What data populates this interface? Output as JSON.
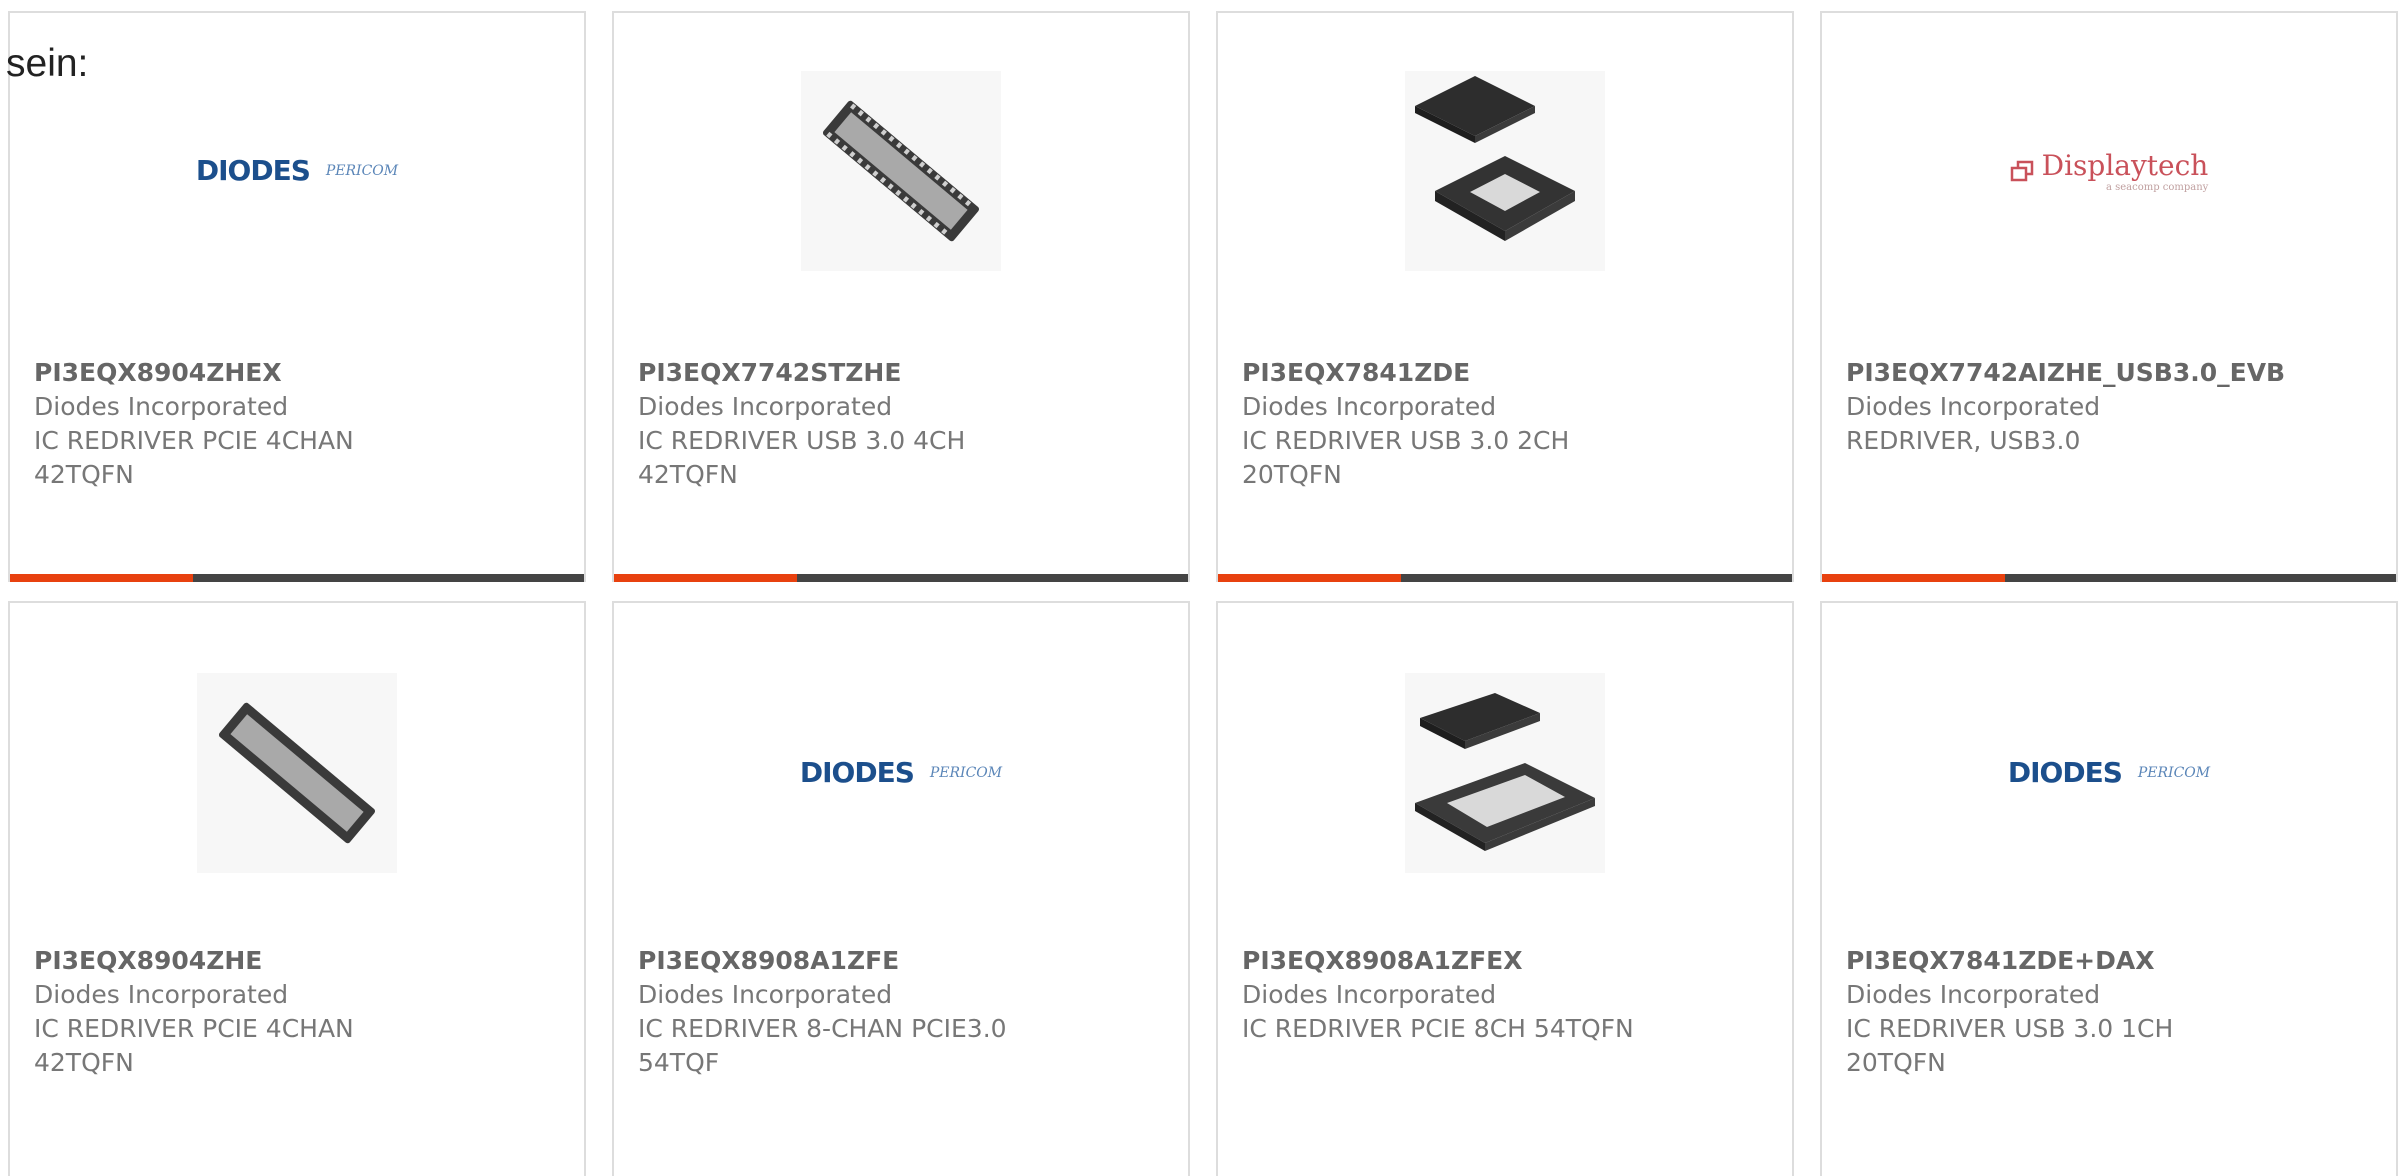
{
  "intro_text": "sein:",
  "colors": {
    "accent": "#e8410f",
    "bar": "#444444",
    "border": "#dddddd"
  },
  "products": [
    {
      "part": "PI3EQX8904ZHEX",
      "manufacturer": "Diodes Incorporated",
      "description": "IC REDRIVER PCIE 4CHAN\n42TQFN",
      "image": "diodes-pericom-logo"
    },
    {
      "part": "PI3EQX7742STZHE",
      "manufacturer": "Diodes Incorporated",
      "description": "IC REDRIVER USB 3.0 4CH\n42TQFN",
      "image": "chip-tqfn-42"
    },
    {
      "part": "PI3EQX7841ZDE",
      "manufacturer": "Diodes Incorporated",
      "description": "IC REDRIVER USB 3.0 2CH\n20TQFN",
      "image": "chip-tqfn-20"
    },
    {
      "part": "PI3EQX7742AIZHE_USB3.0_EVB",
      "manufacturer": "Diodes Incorporated",
      "description": "REDRIVER, USB3.0",
      "image": "displaytech-logo"
    },
    {
      "part": "PI3EQX8904ZHE",
      "manufacturer": "Diodes Incorporated",
      "description": "IC REDRIVER PCIE 4CHAN\n42TQFN",
      "image": "chip-tqfn-42"
    },
    {
      "part": "PI3EQX8908A1ZFE",
      "manufacturer": "Diodes Incorporated",
      "description": "IC REDRIVER 8-CHAN PCIE3.0\n54TQF",
      "image": "diodes-pericom-logo"
    },
    {
      "part": "PI3EQX8908A1ZFEX",
      "manufacturer": "Diodes Incorporated",
      "description": "IC REDRIVER PCIE 8CH 54TQFN",
      "image": "chip-tqfn-54"
    },
    {
      "part": "PI3EQX7841ZDE+DAX",
      "manufacturer": "Diodes Incorporated",
      "description": "IC REDRIVER USB 3.0 1CH\n20TQFN",
      "image": "diodes-pericom-logo"
    }
  ],
  "logos": {
    "diodes": "DIODES",
    "pericom": "PERICOM",
    "displaytech": "Displaytech",
    "displaytech_sub": "a seacomp company"
  }
}
